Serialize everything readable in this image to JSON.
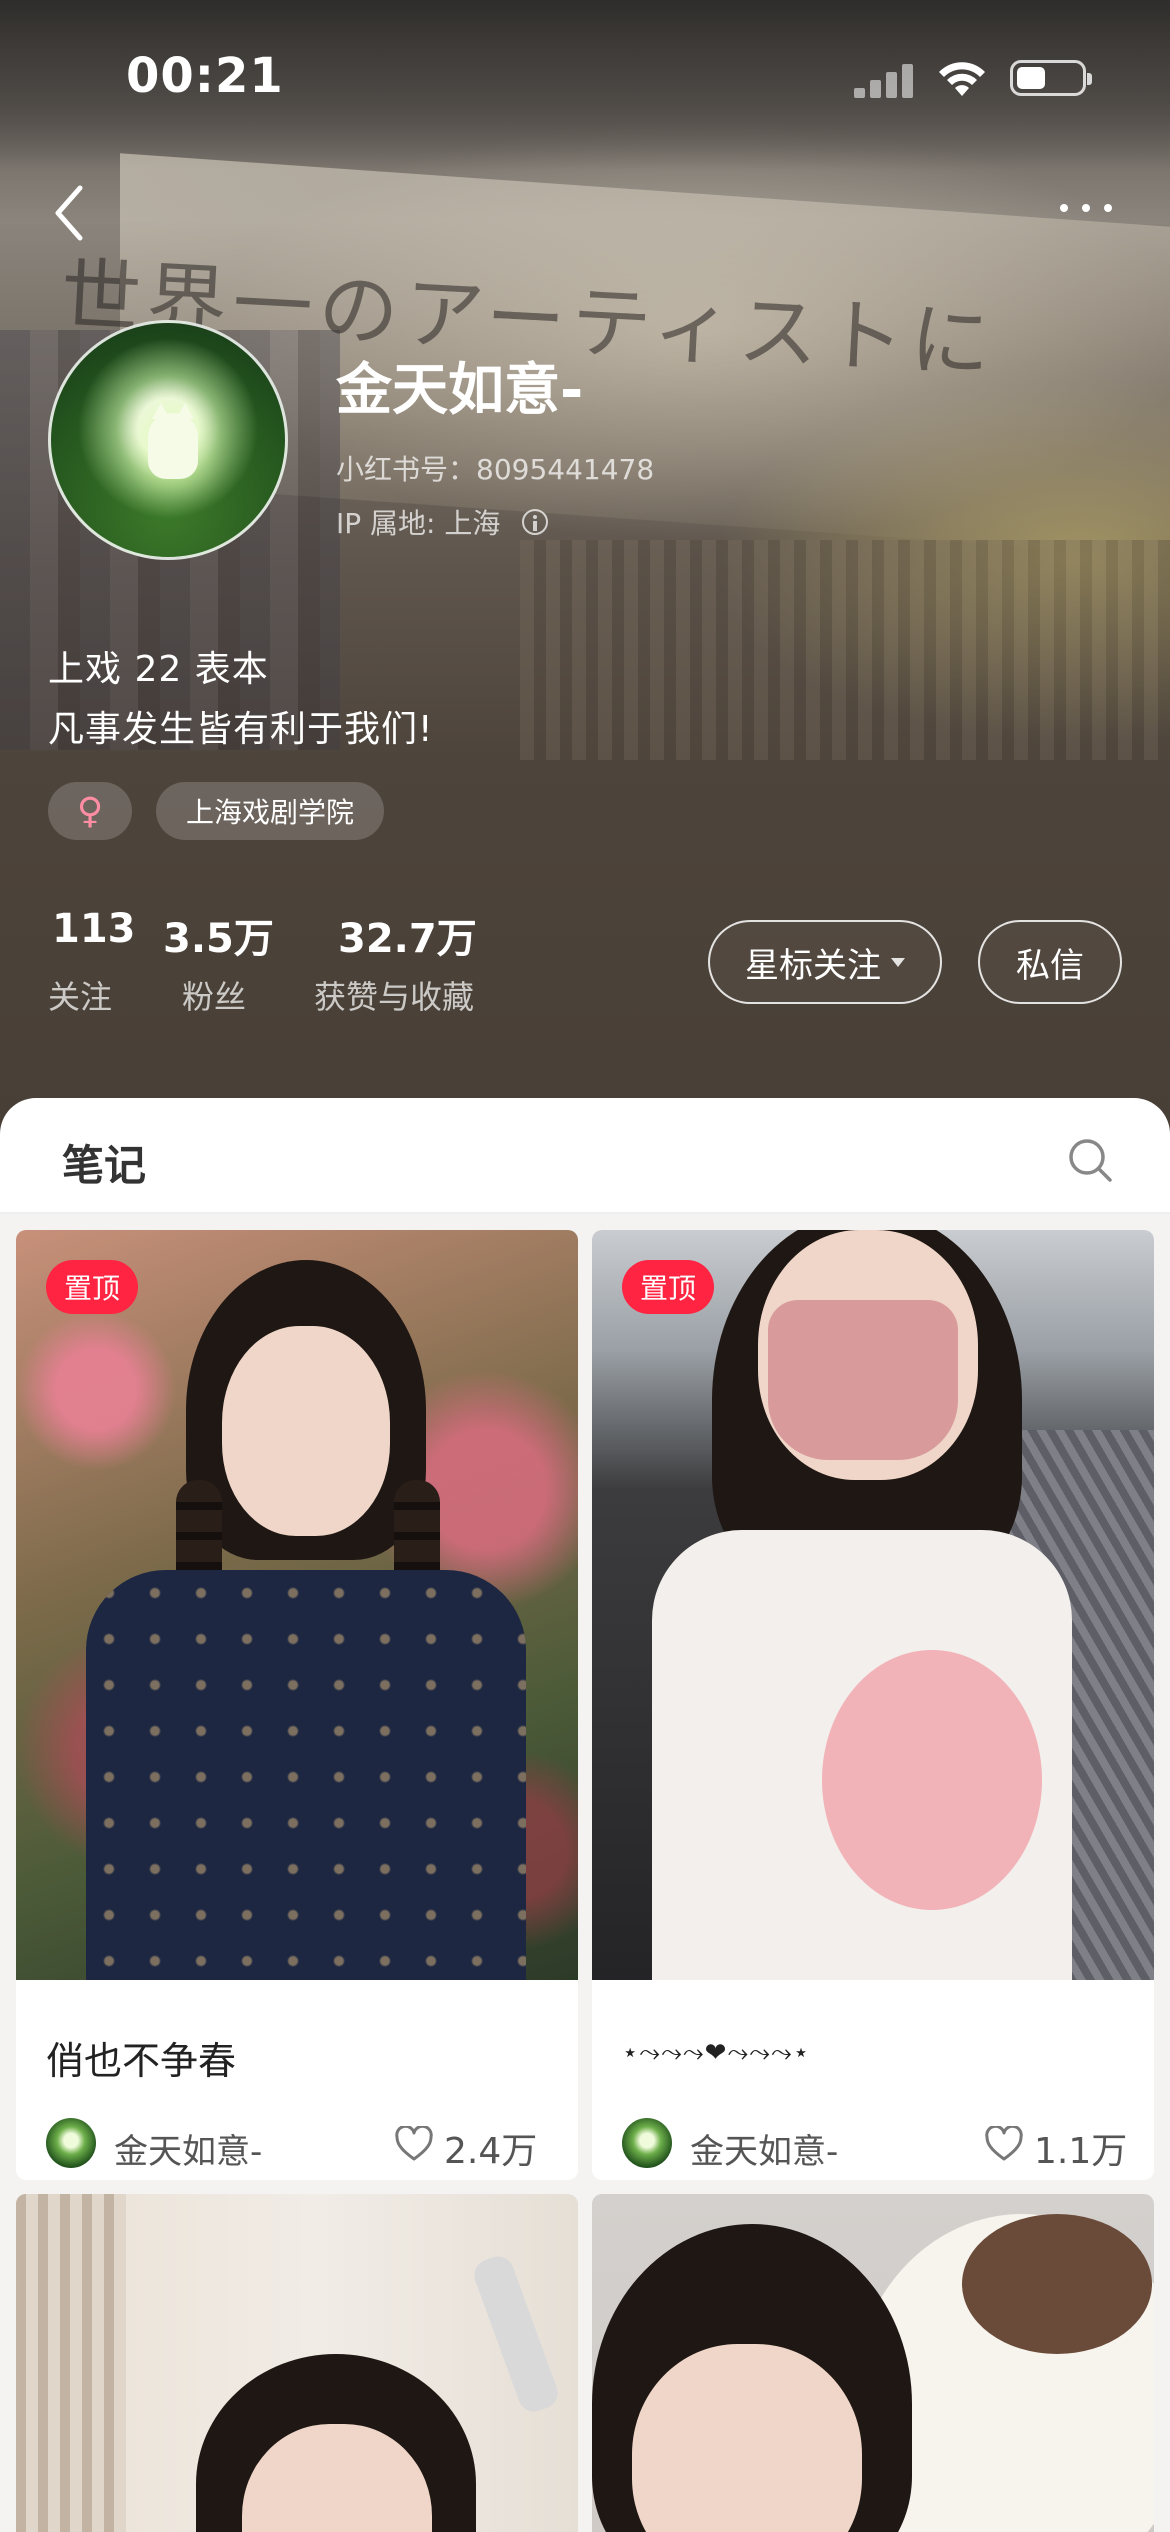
{
  "status_bar": {
    "time": "00:21"
  },
  "profile": {
    "name": "金天如意-",
    "red_id": "小红书号：8095441478",
    "ip_location": "IP 属地: 上海",
    "bio_lines": [
      "上戏 22 表本",
      "凡事发生皆有利于我们!"
    ],
    "tags": {
      "gender_symbol": "♀",
      "school": "上海戏剧学院"
    },
    "stats": [
      {
        "value": "113",
        "label": "关注"
      },
      {
        "value": "3.5万",
        "label": "粉丝"
      },
      {
        "value": "32.7万",
        "label": "获赞与收藏"
      }
    ],
    "buttons": {
      "follow": "星标关注",
      "message": "私信"
    },
    "background_scrawl": "世界一のアーティストになる"
  },
  "notes": {
    "title": "笔记",
    "pin_label": "置顶",
    "cards": [
      {
        "title": "俏也不争春",
        "author": "金天如意-",
        "likes": "2.4万",
        "pinned": true
      },
      {
        "title": "⋆⤳⤳⤳❤︎⤳⤳⤳⋆",
        "author": "金天如意-",
        "likes": "1.1万",
        "pinned": true
      }
    ]
  },
  "icons": {
    "back": "chevron-left-icon",
    "more": "more-dots-icon",
    "search": "search-icon",
    "like": "heart-outline-icon",
    "info": "info-icon"
  },
  "colors": {
    "accent": "#ff2442",
    "gender_pink": "#ff8da4"
  }
}
